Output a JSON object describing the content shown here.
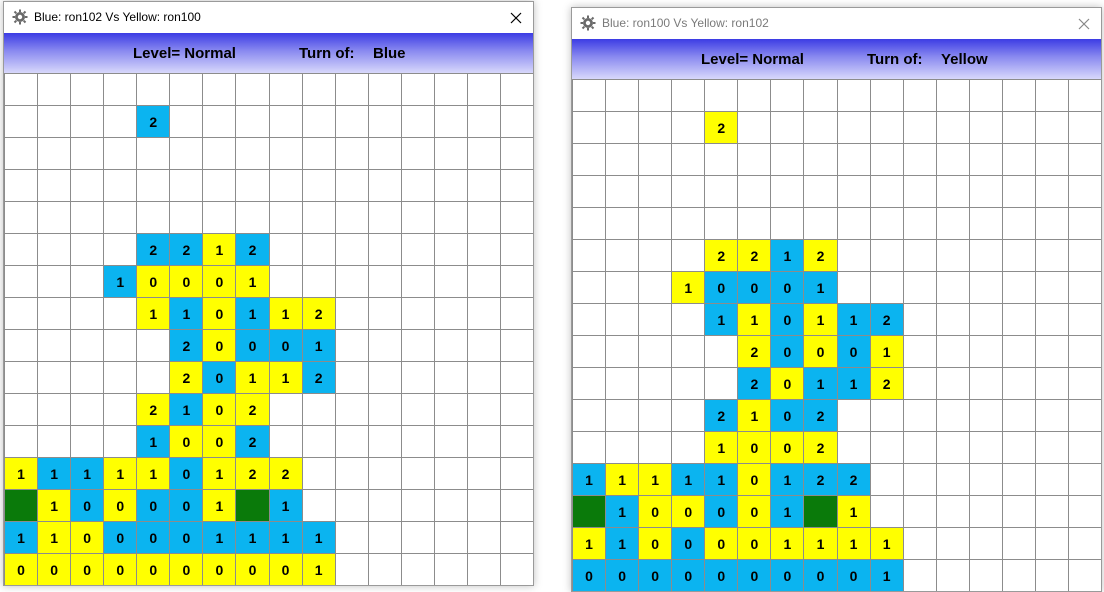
{
  "colors": {
    "blue": "#0bb4f0",
    "yellow": "#ffff00",
    "green": "#0a7a0a",
    "empty": "#ffffff"
  },
  "windows": [
    {
      "title": "Blue: ron102 Vs Yellow: ron100",
      "level_text": "Level=  Normal",
      "turn_label": "Turn of:",
      "turn_value": "Blue",
      "board": [
        "................",
        "....b2..........",
        "................",
        "................",
        "................",
        "....b2b2y1b2....",
        "...b1y0y0y0y1...",
        "....y1b1y0b1y1y2",
        ".....b2y0b0b0b1.",
        ".....y2b0y1y1b2.",
        "....y2b1y0y2....",
        "....b1y0y0b2....",
        "y1b1b1y1y1b0y1y2y2......",
        "Gy1b0y0b0b0y1Gb1.......",
        "b1y1y0b0b0b0b1b1b1b1",
        "y0y0y0y0y0y0y0y0y0y1"
      ]
    },
    {
      "title": "Blue: ron100 Vs Yellow: ron102",
      "level_text": "Level=  Normal",
      "turn_label": "Turn of:",
      "turn_value": "Yellow",
      "board": [
        "................",
        "....y2..........",
        "................",
        "................",
        "................",
        "....y2y2b1y2....",
        "...y1b0b0b0b1...",
        "....b1y1b0y1b1b2",
        ".....y2b0y0b0y1.",
        ".....b2y0b1b1y2.",
        "....b2y1b0b2....",
        "....y1y0y0y2....",
        "b1y1y1b1b1y0b1b2b2......",
        "Gb1y0y0b0y0b1Gy1.......",
        "y1b1y0b0y0y0y1y1y1y1",
        "b0b0b0b0b0b0b0b0b0b1"
      ]
    }
  ]
}
